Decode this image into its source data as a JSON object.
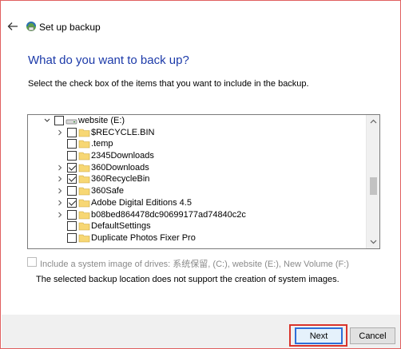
{
  "window": {
    "title": "Set up backup",
    "heading": "What do you want to back up?",
    "instructions": "Select the check box of the items that you want to include in the backup."
  },
  "tree": {
    "drive_label": "website (E:)",
    "items": [
      {
        "label": "$RECYCLE.BIN",
        "checked": false,
        "expandable": true
      },
      {
        "label": ".temp",
        "checked": false,
        "expandable": false
      },
      {
        "label": "2345Downloads",
        "checked": false,
        "expandable": false
      },
      {
        "label": "360Downloads",
        "checked": true,
        "expandable": true
      },
      {
        "label": "360RecycleBin",
        "checked": true,
        "expandable": true
      },
      {
        "label": "360Safe",
        "checked": false,
        "expandable": true
      },
      {
        "label": "Adobe Digital Editions 4.5",
        "checked": true,
        "expandable": true
      },
      {
        "label": "b08bed864478dc90699177ad74840c2c",
        "checked": false,
        "expandable": true
      },
      {
        "label": "DefaultSettings",
        "checked": false,
        "expandable": false
      },
      {
        "label": "Duplicate Photos Fixer Pro",
        "checked": false,
        "expandable": false
      }
    ]
  },
  "system_image": {
    "label": "Include a system image of drives: 系统保留, (C:), website (E:), New Volume (F:)",
    "checked": false,
    "disabled": true
  },
  "note": "The selected backup location does not support the creation of system images.",
  "buttons": {
    "next": "Next",
    "cancel": "Cancel"
  },
  "colors": {
    "heading": "#1c3aa9",
    "highlight": "#d9342b",
    "folder": "#f7d774"
  }
}
